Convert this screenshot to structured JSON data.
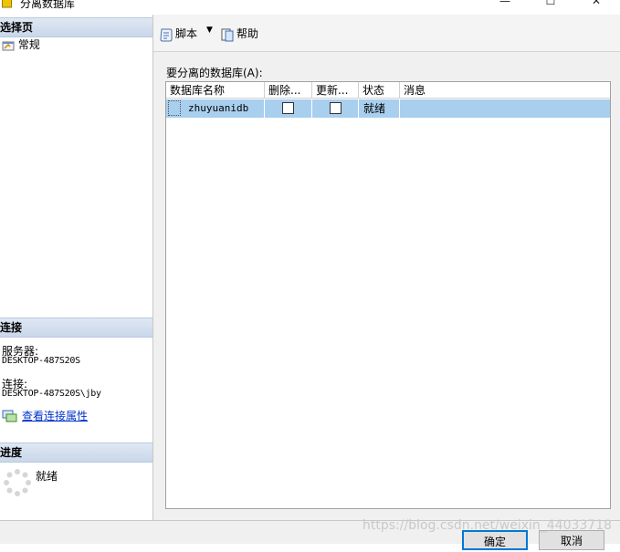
{
  "window": {
    "title": "分离数据库",
    "minimize_symbol": "—",
    "maximize_symbol": "☐",
    "close_symbol": "✕"
  },
  "left_pane": {
    "select_page_header": "选择页",
    "pages": [
      {
        "label": "常规",
        "icon": "settings-page-icon"
      }
    ],
    "connection_header": "连接",
    "server_label": "服务器:",
    "server_value": "DESKTOP-487S20S",
    "connection_label": "连接:",
    "connection_value": "DESKTOP-487S20S\\jby",
    "view_properties_link": "查看连接属性",
    "progress_header": "进度",
    "progress_status": "就绪"
  },
  "toolbar": {
    "script_label": "脚本",
    "script_dropdown": "▼",
    "help_label": "帮助"
  },
  "main": {
    "grid_label": "要分离的数据库(A):",
    "columns": [
      "数据库名称",
      "删除...",
      "更新...",
      "状态",
      "消息"
    ],
    "rows": [
      {
        "name": "zhuyuanidb",
        "drop_connections": false,
        "update_statistics": false,
        "status": "就绪",
        "message": ""
      }
    ]
  },
  "buttons": {
    "ok": "确定",
    "cancel": "取消"
  },
  "watermark": "https://blog.csdn.net/weixin_44033718",
  "colors": {
    "selection": "#a9cfef",
    "section_header": "#c9d7ea",
    "link": "#0033cc",
    "default_button_border": "#0078d7"
  }
}
